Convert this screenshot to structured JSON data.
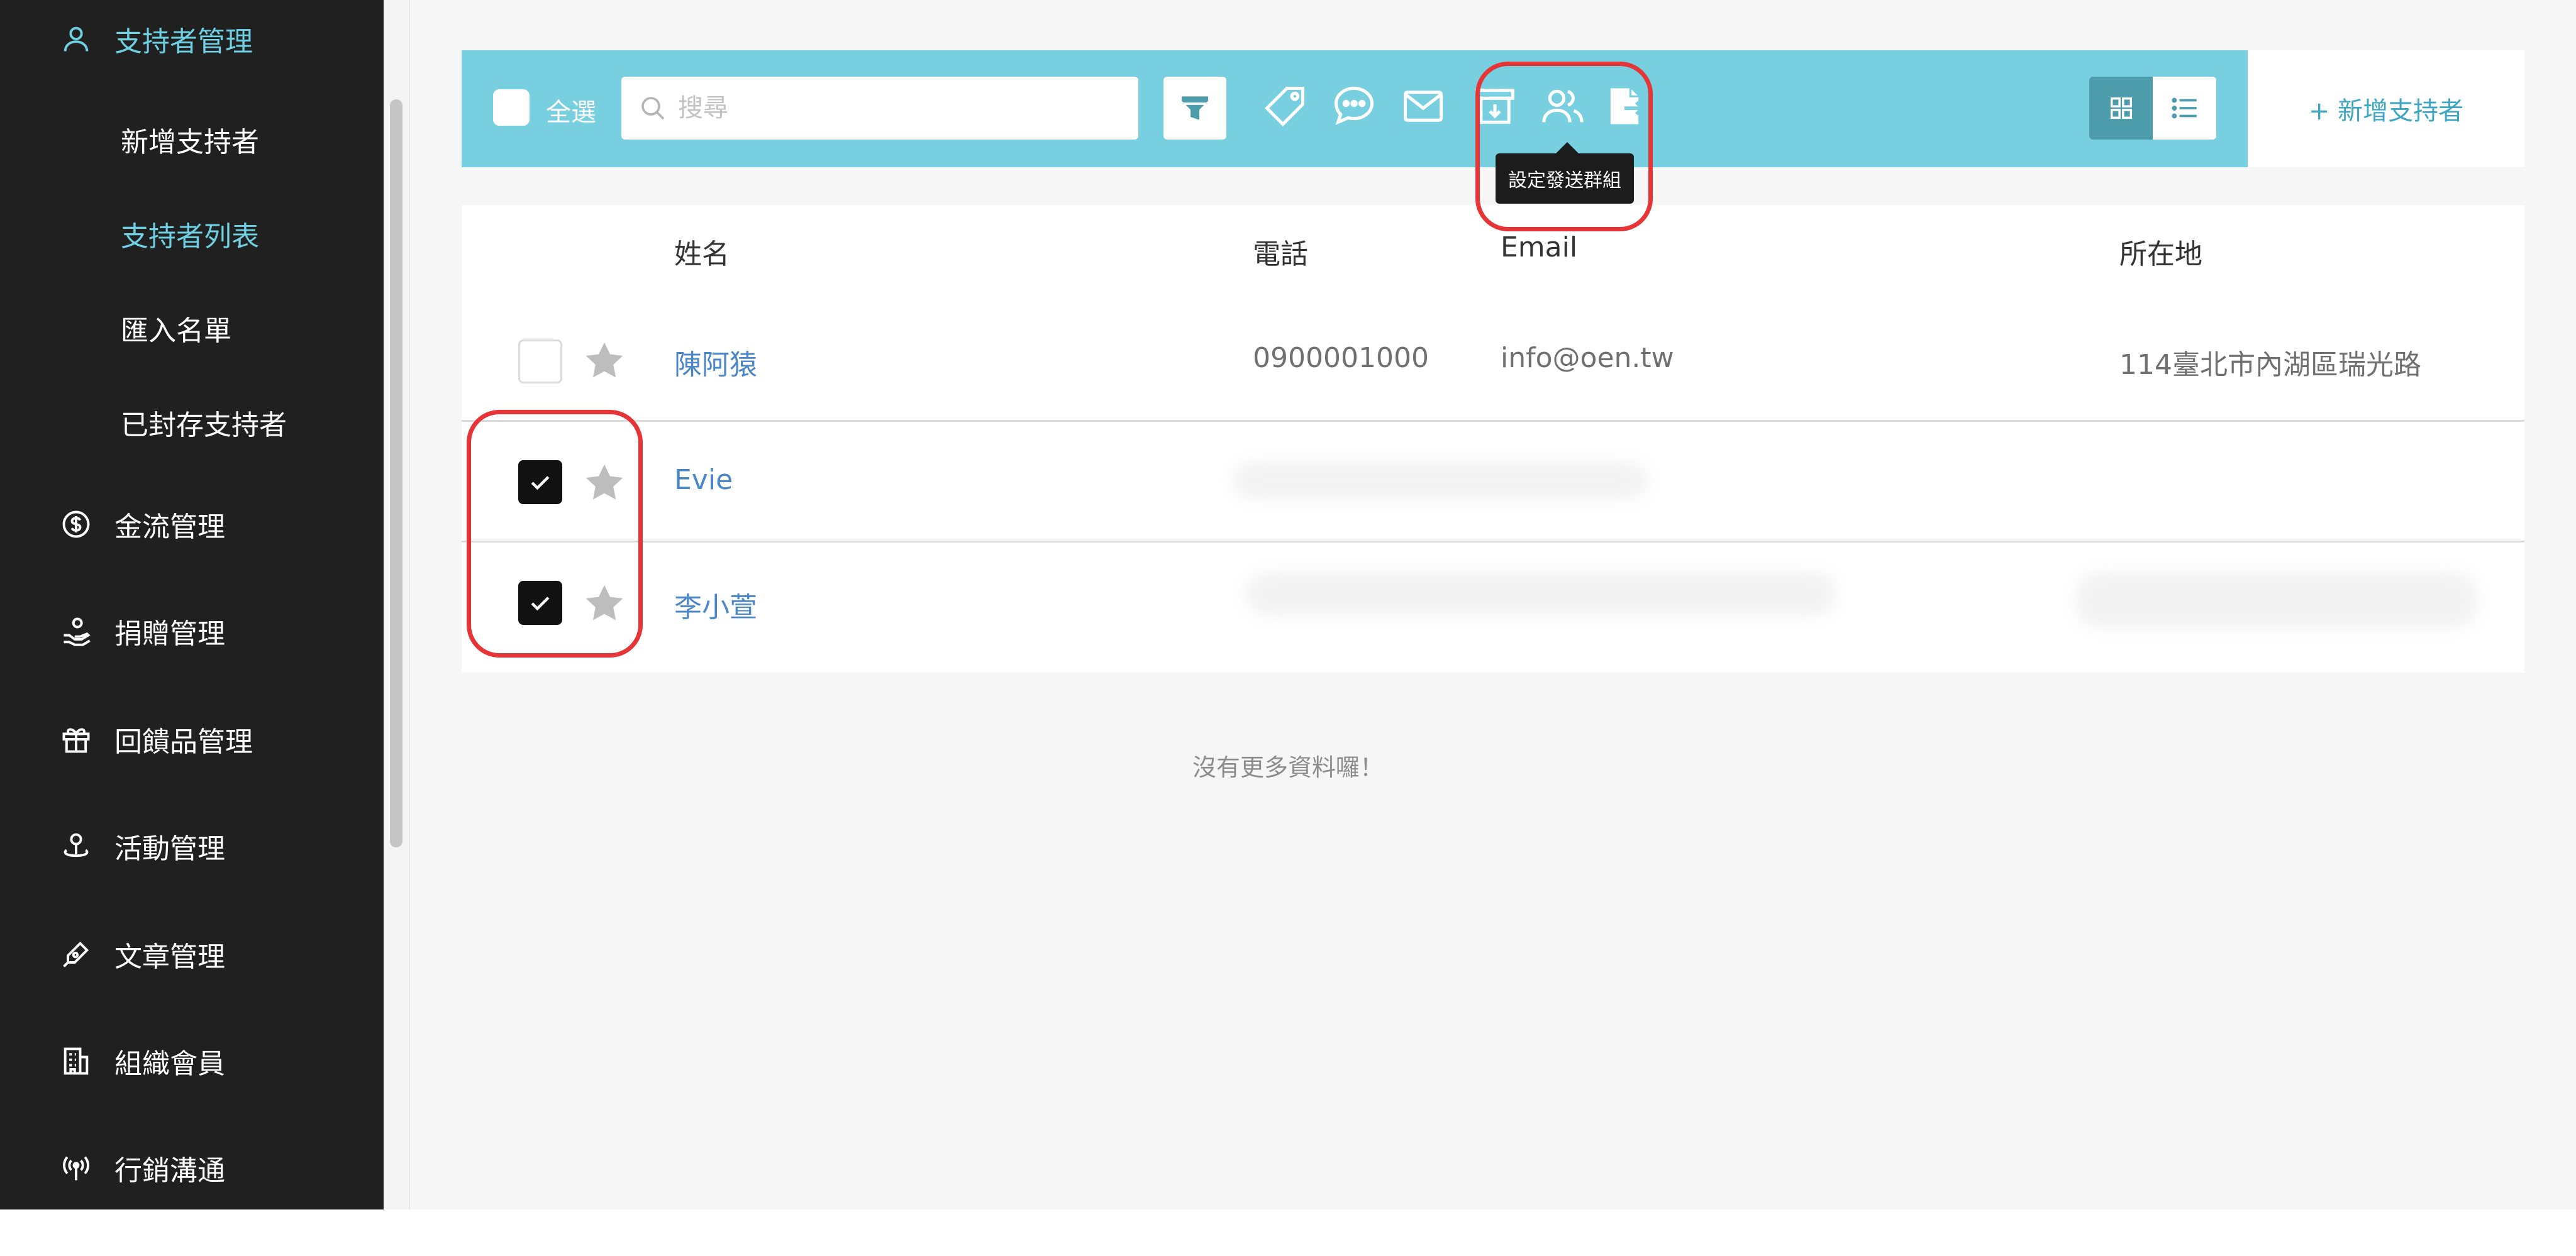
{
  "sidebar": {
    "sections": [
      {
        "label": "支持者管理",
        "icon": "person-icon"
      },
      {
        "label": "金流管理",
        "icon": "dollar-circle-icon"
      },
      {
        "label": "捐贈管理",
        "icon": "donation-hand-icon"
      },
      {
        "label": "回饋品管理",
        "icon": "gift-icon"
      },
      {
        "label": "活動管理",
        "icon": "pin-icon"
      },
      {
        "label": "文章管理",
        "icon": "pen-icon"
      },
      {
        "label": "組織會員",
        "icon": "building-icon"
      },
      {
        "label": "行銷溝通",
        "icon": "broadcast-icon"
      }
    ],
    "sub_items": [
      "新增支持者",
      "支持者列表",
      "匯入名單",
      "已封存支持者"
    ]
  },
  "toolbar": {
    "select_all_label": "全選",
    "search_placeholder": "搜尋",
    "icons": [
      "filter-icon",
      "tag-icon",
      "chat-icon",
      "mail-icon",
      "archive-icon",
      "group-icon",
      "export-icon"
    ],
    "tooltip": "設定發送群組",
    "add_button": "+ 新增支持者"
  },
  "table": {
    "columns": [
      "姓名",
      "電話",
      "Email",
      "所在地"
    ],
    "rows": [
      {
        "name": "陳阿猿",
        "phone": "0900001000",
        "email": "info@oen.tw",
        "location": "114臺北市內湖區瑞光路",
        "checked": false
      },
      {
        "name": "Evie",
        "phone": "",
        "email": "",
        "location": "",
        "checked": true
      },
      {
        "name": "李小萱",
        "phone": "",
        "email": "",
        "location": "",
        "checked": true
      }
    ]
  },
  "footer_text": "沒有更多資料囉！",
  "colors": {
    "sidebar_bg": "#202020",
    "accent": "#6fd0e2",
    "toolbar_bg": "#77cfe0",
    "link": "#4a86c8",
    "highlight": "#e53537"
  }
}
